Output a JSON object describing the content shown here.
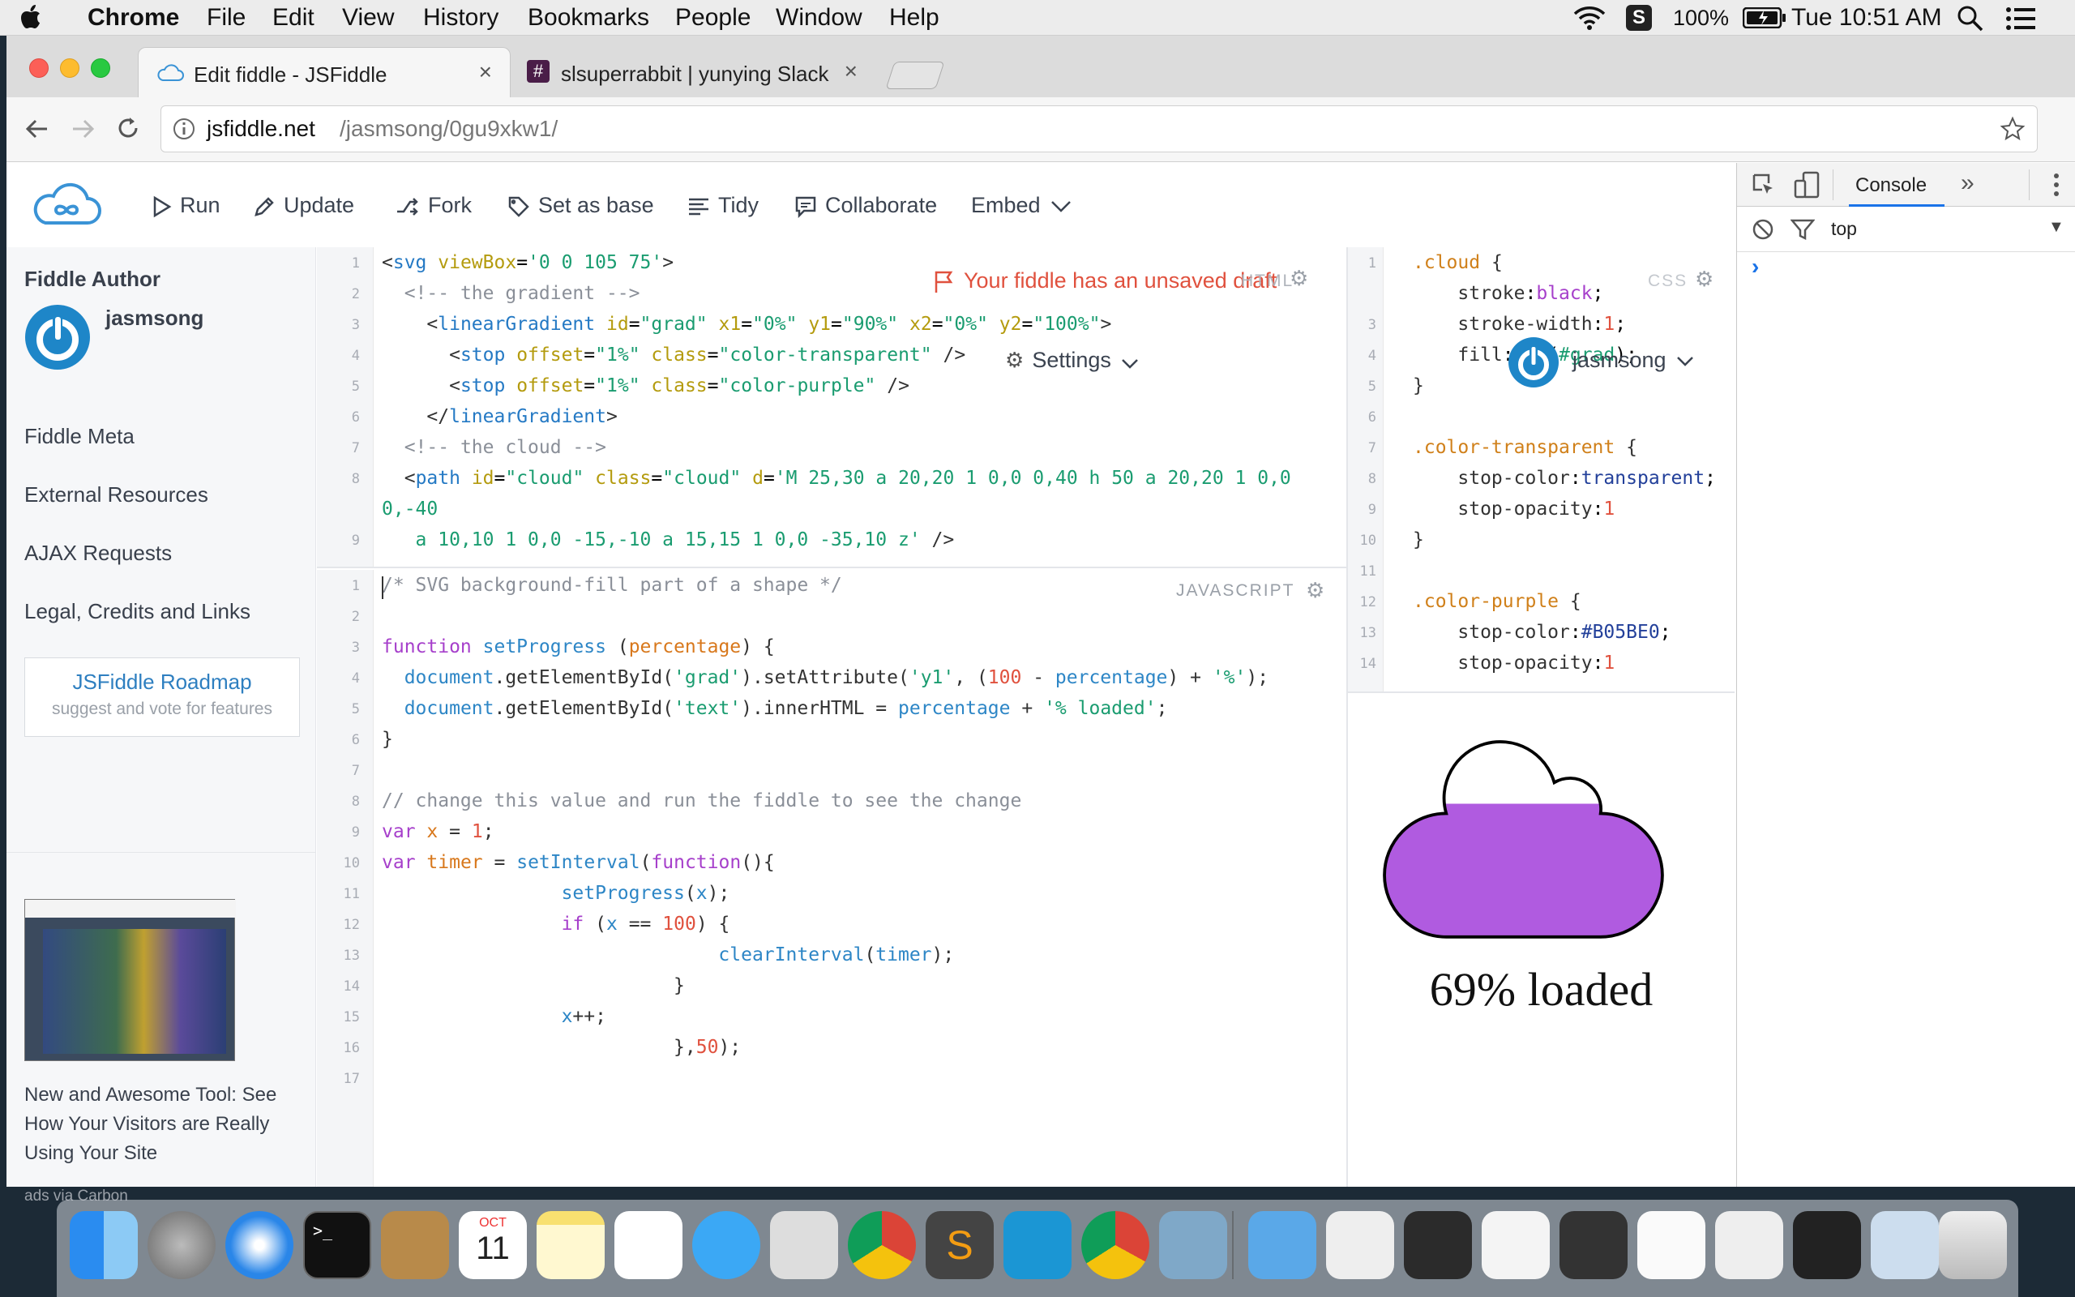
{
  "menubar": {
    "app": "Chrome",
    "items": [
      "File",
      "Edit",
      "View",
      "History",
      "Bookmarks",
      "People",
      "Window",
      "Help"
    ],
    "battery": "100%",
    "clock": "Tue 10:51 AM"
  },
  "tabs": [
    {
      "label": "Edit fiddle - JSFiddle"
    },
    {
      "label": "slsuperrabbit | yunying Slack"
    }
  ],
  "address": {
    "domain": "jsfiddle.net",
    "path": "/jasmsong/0gu9xkw1/"
  },
  "toolbar": {
    "run": "Run",
    "update": "Update",
    "fork": "Fork",
    "set_base": "Set as base",
    "tidy": "Tidy",
    "collaborate": "Collaborate",
    "embed": "Embed"
  },
  "notice": {
    "unsaved": "Your fiddle has an unsaved draft",
    "settings": "Settings",
    "user": "jasmsong"
  },
  "sidebar": {
    "author_heading": "Fiddle Author",
    "author_name": "jasmsong",
    "links": [
      "Fiddle Meta",
      "External Resources",
      "AJAX Requests",
      "Legal, Credits and Links"
    ],
    "roadmap_title": "JSFiddle Roadmap",
    "roadmap_sub": "suggest and vote for features",
    "ad_text": "New and Awesome Tool: See How Your Visitors are Really Using Your Site",
    "ad_credit": "ads via Carbon"
  },
  "panels": {
    "html_label": "HTML",
    "css_label": "CSS",
    "js_label": "JAVASCRIPT"
  },
  "result": {
    "loaded_text": "69% loaded",
    "fill_percent": 69,
    "fill_color": "#B05BE0"
  },
  "devtools": {
    "tab": "Console",
    "context": "top"
  },
  "dock": {
    "calendar_month": "OCT",
    "calendar_day": "11"
  }
}
